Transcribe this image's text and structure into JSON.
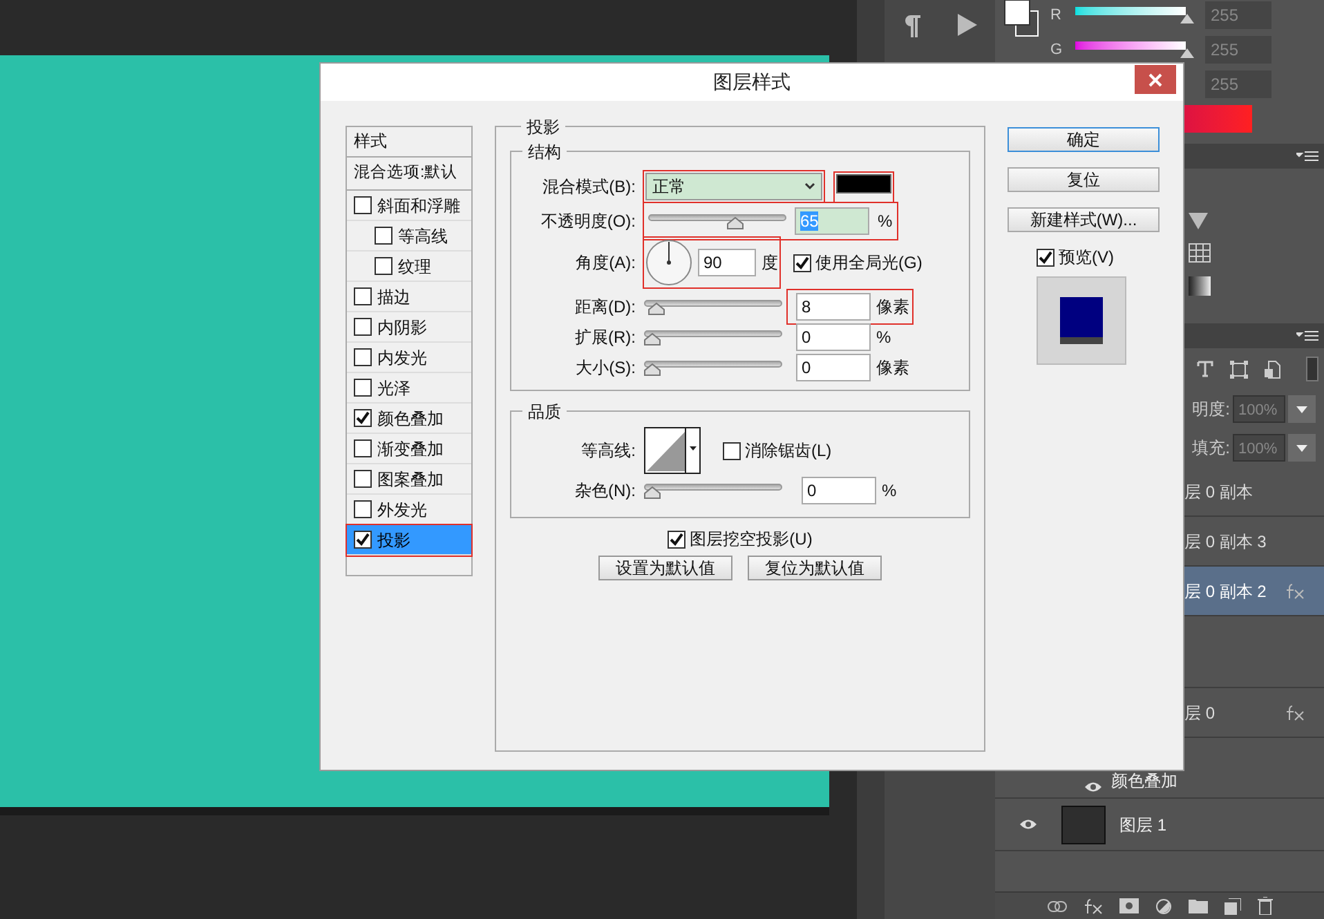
{
  "dialog": {
    "title": "图层样式",
    "styles_header": "样式",
    "blend_options": "混合选项:默认",
    "effects": [
      {
        "label": "斜面和浮雕",
        "checked": false,
        "selected": false,
        "marked": false,
        "children": [
          {
            "label": "等高线",
            "checked": false,
            "selected": false,
            "marked": false
          },
          {
            "label": "纹理",
            "checked": false,
            "selected": false,
            "marked": false
          }
        ]
      },
      {
        "label": "描边",
        "checked": false,
        "selected": false,
        "marked": false
      },
      {
        "label": "内阴影",
        "checked": false,
        "selected": false,
        "marked": false
      },
      {
        "label": "内发光",
        "checked": false,
        "selected": false,
        "marked": false
      },
      {
        "label": "光泽",
        "checked": false,
        "selected": false,
        "marked": false
      },
      {
        "label": "颜色叠加",
        "checked": true,
        "selected": false,
        "marked": false
      },
      {
        "label": "渐变叠加",
        "checked": false,
        "selected": false,
        "marked": false
      },
      {
        "label": "图案叠加",
        "checked": false,
        "selected": false,
        "marked": false
      },
      {
        "label": "外发光",
        "checked": false,
        "selected": false,
        "marked": false
      },
      {
        "label": "投影",
        "checked": true,
        "selected": true,
        "marked": true
      }
    ],
    "section_title": "投影",
    "structure": {
      "title": "结构",
      "blend_mode": {
        "label": "混合模式(B):",
        "value": "正常",
        "marked": true
      },
      "shadow_color": {
        "marked": true
      },
      "opacity": {
        "label": "不透明度(O):",
        "level": 0.65,
        "value": "65",
        "unit": "%",
        "marked": true
      },
      "angle": {
        "label": "角度(A):",
        "value": "90",
        "unit": "度",
        "marked": true
      },
      "global_light": {
        "label": "使用全局光(G)",
        "checked": true
      },
      "sliders": [
        {
          "label": "距离(D):",
          "level": 0.03,
          "value": "8",
          "unit": "像素",
          "marked": true
        },
        {
          "label": "扩展(R):",
          "level": 0,
          "value": "0",
          "unit": "%",
          "marked": false
        },
        {
          "label": "大小(S):",
          "level": 0,
          "value": "0",
          "unit": "像素",
          "marked": false
        }
      ]
    },
    "quality": {
      "title": "品质",
      "contour_label": "等高线:",
      "anti_alias": {
        "label": "消除锯齿(L)",
        "checked": false
      },
      "noise": {
        "label": "杂色(N):",
        "level": 0,
        "value": "0",
        "unit": "%"
      }
    },
    "knockout": {
      "label": "图层挖空投影(U)",
      "checked": true
    },
    "default_buttons": [
      "设置为默认值",
      "复位为默认值"
    ],
    "side_buttons": [
      {
        "label": "确定",
        "default": true
      },
      {
        "label": "复位",
        "default": false
      },
      {
        "label": "新建样式(W)...",
        "default": false
      }
    ],
    "preview": {
      "label": "预览(V)",
      "checked": true
    }
  },
  "color_panel": {
    "channels": [
      {
        "label": "R",
        "value": "255",
        "level": 1
      },
      {
        "label": "G",
        "value": "255",
        "level": 1
      },
      {
        "value": "255",
        "level": 1
      }
    ]
  },
  "layers_panel": {
    "opacity_label": "明度:",
    "opacity_value": "100%",
    "fill_label": "填充:",
    "fill_value": "100%",
    "layers": [
      {
        "kind": "layer",
        "label": "层 0 副本",
        "selected": false,
        "fx": false
      },
      {
        "kind": "layer",
        "label": "层 0 副本 3",
        "selected": false,
        "fx": false
      },
      {
        "kind": "layer",
        "label": "层 0 副本 2",
        "selected": true,
        "fx": true
      },
      {
        "kind": "gap"
      },
      {
        "kind": "layer",
        "label": "层 0",
        "selected": false,
        "fx": true
      },
      {
        "kind": "effect",
        "label": "颜色叠加"
      },
      {
        "kind": "thumb",
        "label": "图层 1"
      }
    ]
  }
}
